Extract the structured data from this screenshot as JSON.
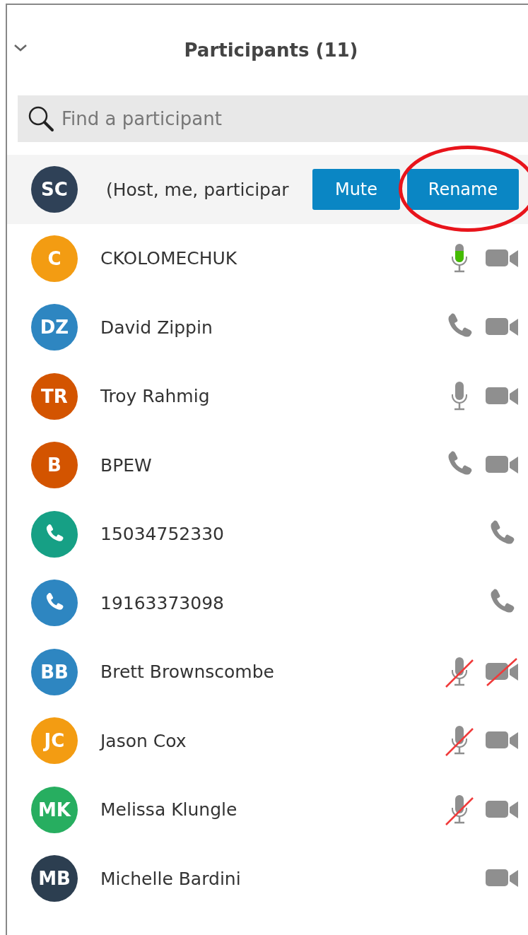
{
  "panel": {
    "title": "Participants (11)",
    "collapsed": false
  },
  "search": {
    "placeholder": "Find a participant"
  },
  "host": {
    "avatar": {
      "kind": "initials",
      "initials": "SC",
      "color": "#2f4157"
    },
    "name": "(Host, me, participar",
    "buttons": [
      {
        "label": "Mute",
        "annotated": false
      },
      {
        "label": "Rename",
        "annotated": true
      }
    ]
  },
  "participants": [
    {
      "avatar": {
        "kind": "initials",
        "initials": "C",
        "color": "#f39c12"
      },
      "name": "CKOLOMECHUK",
      "audio": {
        "kind": "mic",
        "speaking": true,
        "muted": false
      },
      "video": {
        "kind": "camera",
        "muted": false
      }
    },
    {
      "avatar": {
        "kind": "initials",
        "initials": "DZ",
        "color": "#2e86c1"
      },
      "name": "David Zippin",
      "audio": {
        "kind": "phone"
      },
      "video": {
        "kind": "camera",
        "muted": false
      }
    },
    {
      "avatar": {
        "kind": "initials",
        "initials": "TR",
        "color": "#d35400"
      },
      "name": "Troy Rahmig",
      "audio": {
        "kind": "mic",
        "speaking": false,
        "muted": false
      },
      "video": {
        "kind": "camera",
        "muted": false
      }
    },
    {
      "avatar": {
        "kind": "initials",
        "initials": "B",
        "color": "#d35400"
      },
      "name": "BPEW",
      "audio": {
        "kind": "phone"
      },
      "video": {
        "kind": "camera",
        "muted": false
      }
    },
    {
      "avatar": {
        "kind": "phone",
        "color": "#16a085"
      },
      "name": "15034752330",
      "audio": {
        "kind": "phone"
      }
    },
    {
      "avatar": {
        "kind": "phone",
        "color": "#2e86c1"
      },
      "name": "19163373098",
      "audio": {
        "kind": "phone"
      }
    },
    {
      "avatar": {
        "kind": "initials",
        "initials": "BB",
        "color": "#2e86c1"
      },
      "name": "Brett Brownscombe",
      "audio": {
        "kind": "mic",
        "speaking": false,
        "muted": true
      },
      "video": {
        "kind": "camera",
        "muted": true
      }
    },
    {
      "avatar": {
        "kind": "initials",
        "initials": "JC",
        "color": "#f39c12"
      },
      "name": "Jason Cox",
      "audio": {
        "kind": "mic",
        "speaking": false,
        "muted": true
      },
      "video": {
        "kind": "camera",
        "muted": false
      }
    },
    {
      "avatar": {
        "kind": "initials",
        "initials": "MK",
        "color": "#27ae60"
      },
      "name": "Melissa Klungle",
      "audio": {
        "kind": "mic",
        "speaking": false,
        "muted": true
      },
      "video": {
        "kind": "camera",
        "muted": false
      }
    },
    {
      "avatar": {
        "kind": "initials",
        "initials": "MB",
        "color": "#2c3e50"
      },
      "name": "Michelle Bardini",
      "video": {
        "kind": "camera",
        "muted": false
      }
    }
  ]
}
